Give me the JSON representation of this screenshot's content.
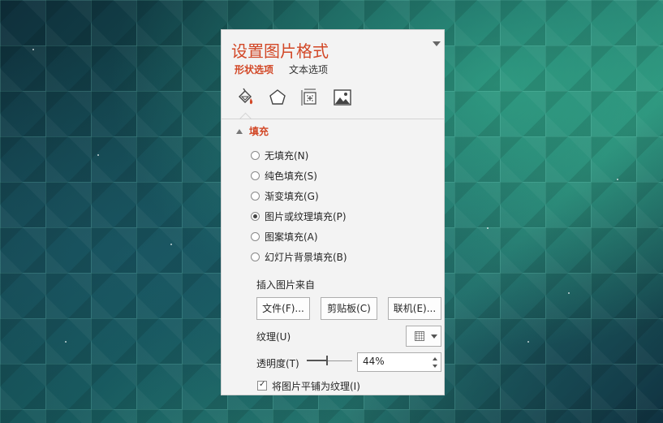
{
  "panel": {
    "title": "设置图片格式",
    "tabs": [
      {
        "label": "形状选项",
        "active": true
      },
      {
        "label": "文本选项",
        "active": false
      }
    ],
    "icons": [
      "fill-line-icon",
      "effects-pentagon-icon",
      "size-properties-icon",
      "picture-icon"
    ]
  },
  "fill": {
    "section_label": "填充",
    "options": [
      {
        "label": "无填充(N)",
        "selected": false
      },
      {
        "label": "纯色填充(S)",
        "selected": false
      },
      {
        "label": "渐变填充(G)",
        "selected": false
      },
      {
        "label": "图片或纹理填充(P)",
        "selected": true
      },
      {
        "label": "图案填充(A)",
        "selected": false
      },
      {
        "label": "幻灯片背景填充(B)",
        "selected": false
      }
    ],
    "insert_from_label": "插入图片来自",
    "buttons": {
      "file": "文件(F)...",
      "clipboard": "剪贴板(C)",
      "online": "联机(E)..."
    },
    "texture_label": "纹理(U)",
    "transparency_label": "透明度(T)",
    "transparency_value": "44%",
    "transparency_fraction": 0.44,
    "tile_label": "将图片平铺为纹理(I)",
    "tile_checked": true
  },
  "colors": {
    "accent": "#d24726",
    "panel_bg": "#f3f3f3"
  }
}
